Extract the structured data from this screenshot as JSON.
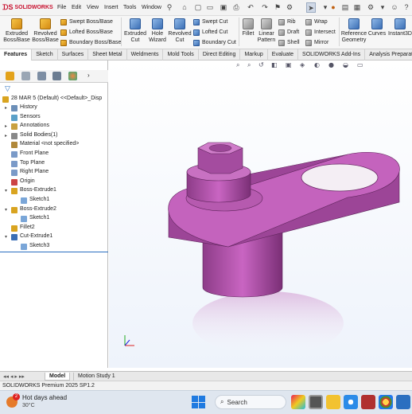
{
  "app": {
    "logo_text": "SOLIDWORKS"
  },
  "menu": [
    "File",
    "Edit",
    "View",
    "Insert",
    "Tools",
    "Window"
  ],
  "commands": {
    "extruded_boss_base": "Extruded\nBoss/Base",
    "revolved_boss_base": "Revolved\nBoss/Base",
    "swept_boss_base": "Swept Boss/Base",
    "lofted_boss_base": "Lofted Boss/Base",
    "boundary_boss_base": "Boundary Boss/Base",
    "extruded_cut": "Extruded\nCut",
    "hole_wizard": "Hole\nWizard",
    "revolved_cut": "Revolved\nCut",
    "swept_cut": "Swept Cut",
    "lofted_cut": "Lofted Cut",
    "boundary_cut": "Boundary Cut",
    "fillet": "Fillet",
    "linear_pattern": "Linear\nPattern",
    "rib": "Rib",
    "draft": "Draft",
    "shell": "Shell",
    "wrap": "Wrap",
    "intersect": "Intersect",
    "mirror": "Mirror",
    "reference_geometry": "Reference\nGeometry",
    "curves": "Curves",
    "instant3d": "Instant3D"
  },
  "tabs": [
    "Features",
    "Sketch",
    "Surfaces",
    "Sheet Metal",
    "Weldments",
    "Mold Tools",
    "Direct Editing",
    "Markup",
    "Evaluate",
    "SOLIDWORKS Add-Ins",
    "Analysis Preparation"
  ],
  "active_tab": "Features",
  "tree": {
    "root": "28 MAR 5 (Default) <<Default>_Disp",
    "items": [
      {
        "label": "History",
        "expander": "▸"
      },
      {
        "label": "Sensors",
        "expander": ""
      },
      {
        "label": "Annotations",
        "expander": "▸"
      },
      {
        "label": "Solid Bodies(1)",
        "expander": "▸"
      },
      {
        "label": "Material <not specified>",
        "expander": ""
      },
      {
        "label": "Front Plane",
        "expander": ""
      },
      {
        "label": "Top Plane",
        "expander": ""
      },
      {
        "label": "Right Plane",
        "expander": ""
      },
      {
        "label": "Origin",
        "expander": ""
      },
      {
        "label": "Boss-Extrude1",
        "expander": "▾"
      },
      {
        "label": "Sketch1",
        "expander": ""
      },
      {
        "label": "Boss-Extrude2",
        "expander": "▾"
      },
      {
        "label": "Sketch1",
        "expander": ""
      },
      {
        "label": "Fillet2",
        "expander": ""
      },
      {
        "label": "Cut-Extrude1",
        "expander": "▾"
      },
      {
        "label": "Sketch3",
        "expander": ""
      }
    ]
  },
  "bottom_tabs": [
    "Model",
    "Motion Study 1"
  ],
  "status_text": "SOLIDWORKS Premium 2025 SP1.2",
  "taskbar": {
    "weather_title": "Hot days ahead",
    "weather_temp": "30°C",
    "weather_badge": "2",
    "search_placeholder": "Search"
  },
  "colors": {
    "part": "#b84fb0",
    "accent": "#c8102e"
  }
}
